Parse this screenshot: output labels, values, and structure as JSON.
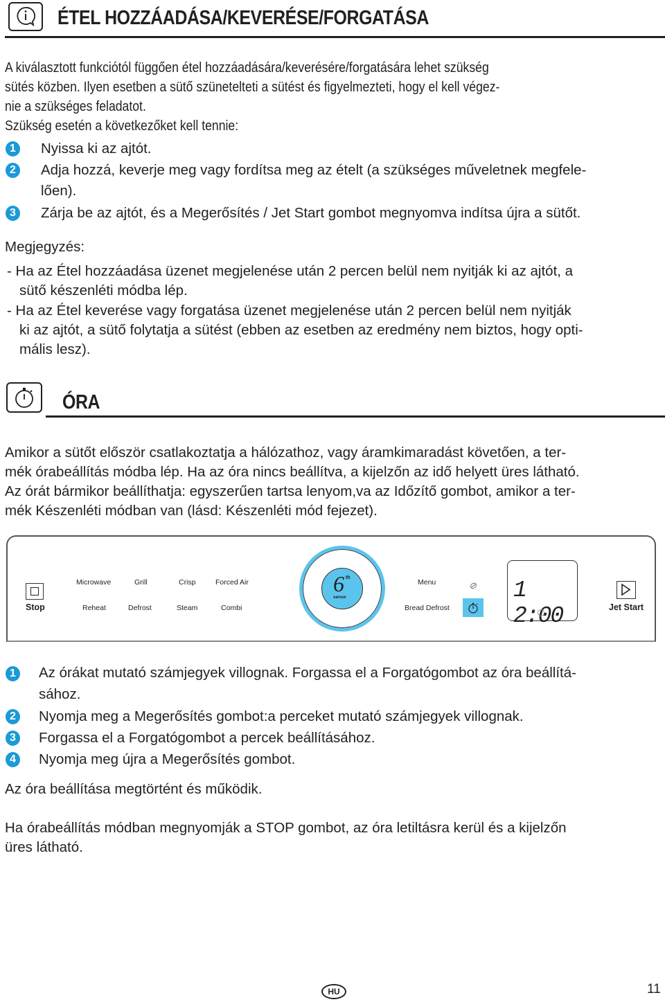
{
  "section1": {
    "icon": "info-speech-bubble-icon",
    "title": "ÉTEL HOZZÁADÁSA/KEVERÉSE/FORGATÁSA",
    "intro_lines": [
      "A kiválasztott funkciótól függően étel hozzáadására/keverésére/forgatására lehet szükség",
      "sütés közben. Ilyen esetben a sütő szünetelteti a sütést és figyelmezteti, hogy el kell végez-",
      "nie a szükséges feladatot.",
      "Szükség esetén a következőket kell tennie:"
    ],
    "steps": [
      {
        "num": "1",
        "lines": [
          "Nyissa ki az ajtót."
        ]
      },
      {
        "num": "2",
        "lines": [
          "Adja hozzá, keverje meg vagy fordítsa meg az ételt (a szükséges műveletnek megfele-",
          "lően)."
        ]
      },
      {
        "num": "3",
        "lines": [
          "Zárja be az ajtót, és a Megerősítés / Jet Start gombot megnyomva indítsa újra a sütőt."
        ]
      }
    ],
    "note_label": "Megjegyzés:",
    "notes": [
      [
        "- Ha az Étel hozzáadása üzenet megjelenése után 2 percen belül nem nyitják ki az ajtót, a",
        "sütő készenléti módba lép."
      ],
      [
        "- Ha az Étel keverése vagy forgatása üzenet megjelenése után 2 percen belül nem nyitják",
        "ki az ajtót, a sütő folytatja a sütést (ebben az esetben az eredmény nem biztos, hogy opti-",
        "mális lesz)."
      ]
    ]
  },
  "section2": {
    "icon": "stopwatch-icon",
    "title": "ÓRA",
    "intro_lines": [
      "Amikor a sütőt először csatlakoztatja a hálózathoz, vagy áramkimaradást követően, a ter-",
      "mék órabeállítás módba lép. Ha az óra nincs beállítva, a kijelzőn az idő helyett üres látható.",
      "Az órát bármikor beállíthatja: egyszerűen tartsa lenyom,va az Időzítő gombot, amikor a ter-",
      "mék Készenléti módban van (lásd: Készenléti mód fejezet)."
    ],
    "panel": {
      "stop_label": "Stop",
      "row1": [
        "Microwave",
        "Grill",
        "Crisp",
        "Forced Air"
      ],
      "row2": [
        "Reheat",
        "Defrost",
        "Steam",
        "Combi"
      ],
      "dial_main": "6",
      "dial_sup": "th",
      "dial_sub": "sense",
      "menu_label": "Menu",
      "bread_defrost_label": "Bread Defrost",
      "display_time": "1 2:00",
      "jet_start_label": "Jet Start",
      "accent_color": "#5bc4ec"
    },
    "steps": [
      {
        "num": "1",
        "lines": [
          "Az órákat mutató számjegyek villognak. Forgassa el a Forgatógombot az óra beállítá-",
          "sához."
        ]
      },
      {
        "num": "2",
        "lines": [
          "Nyomja meg a Megerősítés gombot:a perceket mutató számjegyek villognak."
        ]
      },
      {
        "num": "3",
        "lines": [
          "Forgassa el a Forgatógombot a percek beállításához."
        ]
      },
      {
        "num": "4",
        "lines": [
          "Nyomja meg újra a Megerősítés gombot."
        ]
      }
    ],
    "after": "Az óra beállítása megtörtént és működik.",
    "stop_note_lines": [
      "Ha órabeállítás módban megnyomják a STOP gombot, az óra letiltásra kerül és a kijelzőn",
      "üres látható."
    ]
  },
  "footer": {
    "lang_badge": "HU",
    "page_number": "11"
  }
}
